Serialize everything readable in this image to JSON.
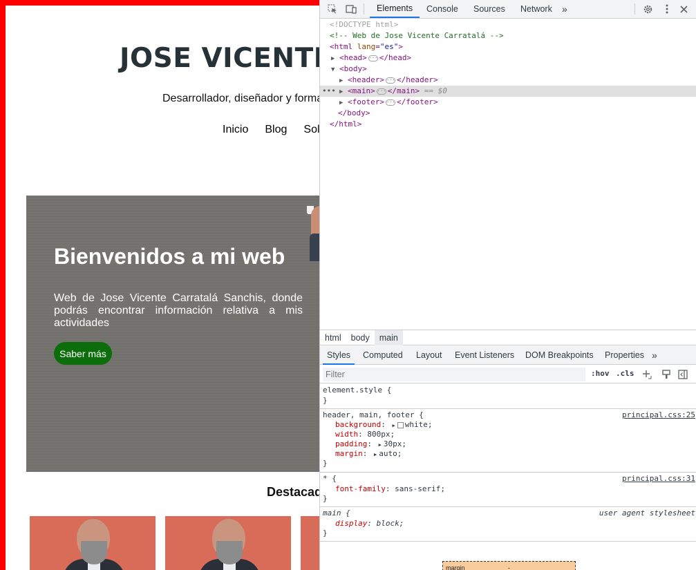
{
  "site": {
    "title": "JOSE VICENTE",
    "tagline": "Desarrollador, diseñador y forma",
    "nav": [
      "Inicio",
      "Blog",
      "Sol"
    ],
    "hero": {
      "title": "Bienvenidos a mi web",
      "text": "Web de Jose Vicente Carratalá Sanchis, donde podrás encontrar información relativa a mis actividades",
      "button": "Saber más"
    },
    "featured_title": "Destacad",
    "colors": {
      "border": "#ff0000",
      "title": "#263238",
      "hero_bg": "#74726d",
      "button": "#0b6e0b",
      "thumb_bg": "#d86c58"
    }
  },
  "devtools": {
    "toolbar_tools": [
      "inspect-icon",
      "device-toggle-icon"
    ],
    "tabs": [
      "Elements",
      "Console",
      "Sources",
      "Network"
    ],
    "active_tab": "Elements",
    "more_tabs": "»",
    "right_icons": [
      "gear-icon",
      "kebab-menu-icon",
      "close-icon"
    ],
    "dom": {
      "doctype": "<!DOCTYPE html>",
      "comment": "<!-- Web de Jose Vicente Carratalá -->",
      "html_open_tag": "<html ",
      "html_attr": "lang",
      "html_attr_val": "\"es\"",
      "html_close_bracket": ">",
      "head_open": "<head>",
      "head_close": "</head>",
      "body_open": "<body>",
      "header_open": "<header>",
      "header_close": "</header>",
      "main_open": "<main>",
      "main_close": "</main>",
      "selected_marker": "== $0",
      "footer_open": "<footer>",
      "footer_close": "</footer>",
      "body_close": "</body>",
      "html_close": "</html>"
    },
    "breadcrumbs": [
      "html",
      "body",
      "main"
    ],
    "styles_tabs": [
      "Styles",
      "Computed",
      "Layout",
      "Event Listeners",
      "DOM Breakpoints",
      "Properties"
    ],
    "styles_more": "»",
    "filter_placeholder": "Filter",
    "hov": ":hov",
    "cls": ".cls",
    "rules": [
      {
        "selector": "element.style {",
        "declarations": [],
        "close": "}"
      },
      {
        "selector": "header, main, footer {",
        "source": "principal.css:25",
        "declarations": [
          {
            "prop": "background",
            "value": "white;"
          },
          {
            "prop": "width",
            "value": "800px;"
          },
          {
            "prop": "padding",
            "value": "30px;"
          },
          {
            "prop": "margin",
            "value": "auto;"
          }
        ],
        "close": "}"
      },
      {
        "selector": "* {",
        "source": "principal.css:31",
        "declarations": [
          {
            "prop": "font-family",
            "value": "sans-serif;"
          }
        ],
        "close": "}"
      },
      {
        "selector": "main {",
        "source": "user agent stylesheet",
        "declarations": [
          {
            "prop": "display",
            "value": "block;"
          }
        ],
        "close": "}"
      }
    ],
    "boxmodel": {
      "label": "margin",
      "value": "-"
    },
    "colors": {
      "accent": "#1a73e8",
      "tag": "#881280",
      "attr": "#994500",
      "attr_value": "#1a1aa6",
      "comment": "#236e25",
      "property": "#c80000"
    }
  }
}
